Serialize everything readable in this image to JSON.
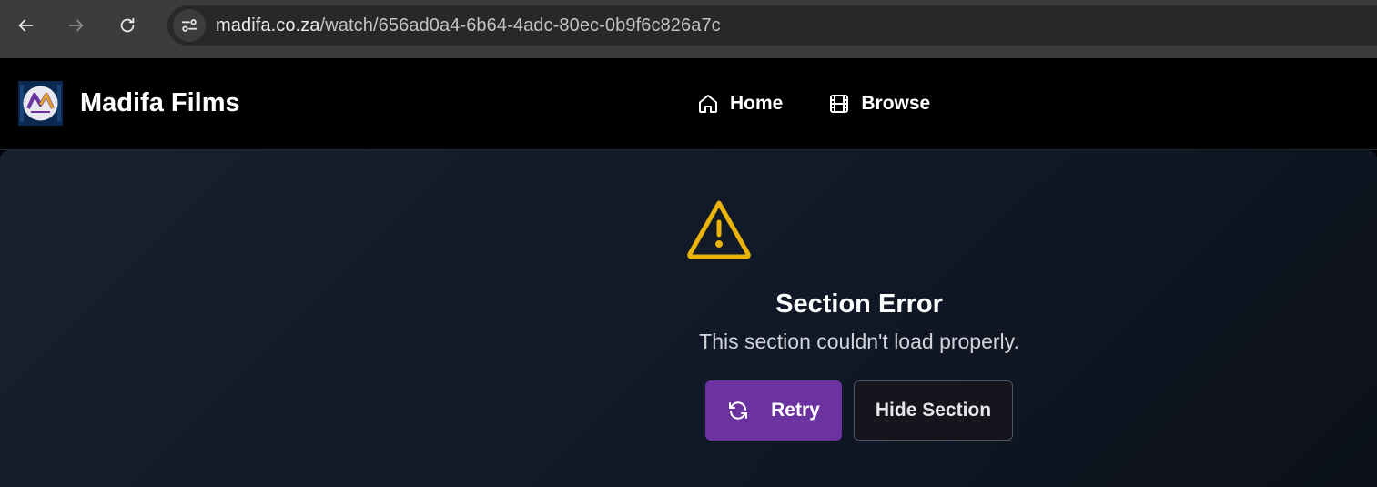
{
  "browser": {
    "url_host": "madifa.co.za",
    "url_path": "/watch/656ad0a4-6b64-4adc-80ec-0b9f6c826a7c",
    "icons": [
      "back-icon",
      "forward-icon",
      "reload-icon",
      "site-info-icon"
    ]
  },
  "header": {
    "brand": "Madifa Films",
    "nav": [
      {
        "label": "Home",
        "icon": "home-icon"
      },
      {
        "label": "Browse",
        "icon": "film-icon"
      }
    ]
  },
  "error": {
    "title": "Section Error",
    "message": "This section couldn't load properly.",
    "retry_label": "Retry",
    "hide_label": "Hide Section",
    "icon": "warning-triangle-icon"
  },
  "colors": {
    "warning": "#eab308",
    "retry_bg": "#6b32a0",
    "content_bg": "#111827"
  }
}
